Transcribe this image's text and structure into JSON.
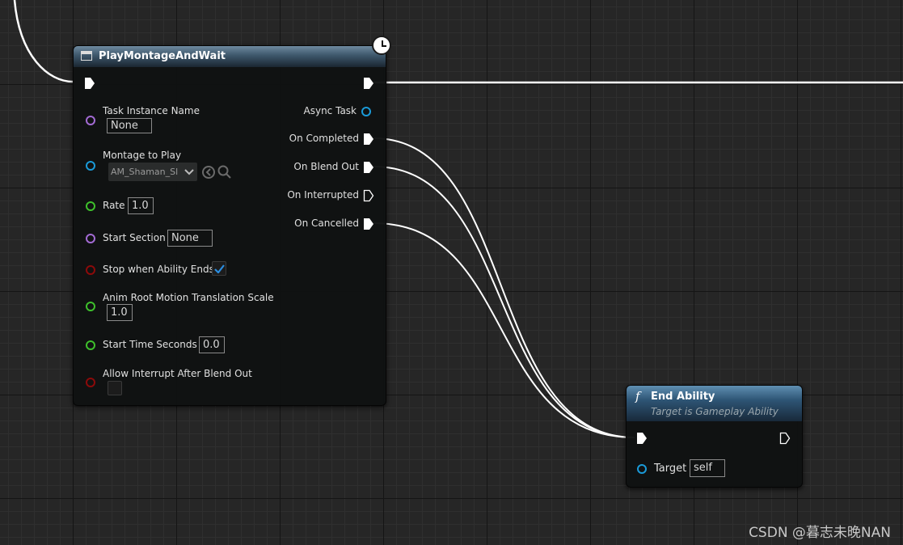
{
  "play_node": {
    "title": "PlayMontageAndWait",
    "inputs": {
      "task_instance_name": {
        "label": "Task Instance Name",
        "value": "None"
      },
      "montage_to_play": {
        "label": "Montage to Play",
        "value": "AM_Shaman_Sl"
      },
      "rate": {
        "label": "Rate",
        "value": "1.0"
      },
      "start_section": {
        "label": "Start Section",
        "value": "None"
      },
      "stop_when_ability_ends": {
        "label": "Stop when Ability Ends",
        "checked": true
      },
      "anim_root_motion": {
        "label": "Anim Root Motion Translation Scale",
        "value": "1.0"
      },
      "start_time_seconds": {
        "label": "Start Time Seconds",
        "value": "0.0"
      },
      "allow_interrupt": {
        "label": "Allow Interrupt After Blend Out",
        "checked": false
      }
    },
    "outputs": {
      "async_task": "Async Task",
      "on_completed": "On Completed",
      "on_blend_out": "On Blend Out",
      "on_interrupted": "On Interrupted",
      "on_cancelled": "On Cancelled"
    }
  },
  "end_node": {
    "title": "End Ability",
    "subtitle": "Target is Gameplay Ability",
    "function_glyph": "f",
    "target_label": "Target",
    "target_value": "self"
  },
  "watermark": "CSDN @暮志未晚NAN",
  "colors": {
    "header": "#3d566a",
    "pin_name": "#a36bd4",
    "pin_object": "#1a9ad8",
    "pin_float": "#3ec02c",
    "pin_bool": "#8c0a0a",
    "exec": "#ffffff"
  }
}
